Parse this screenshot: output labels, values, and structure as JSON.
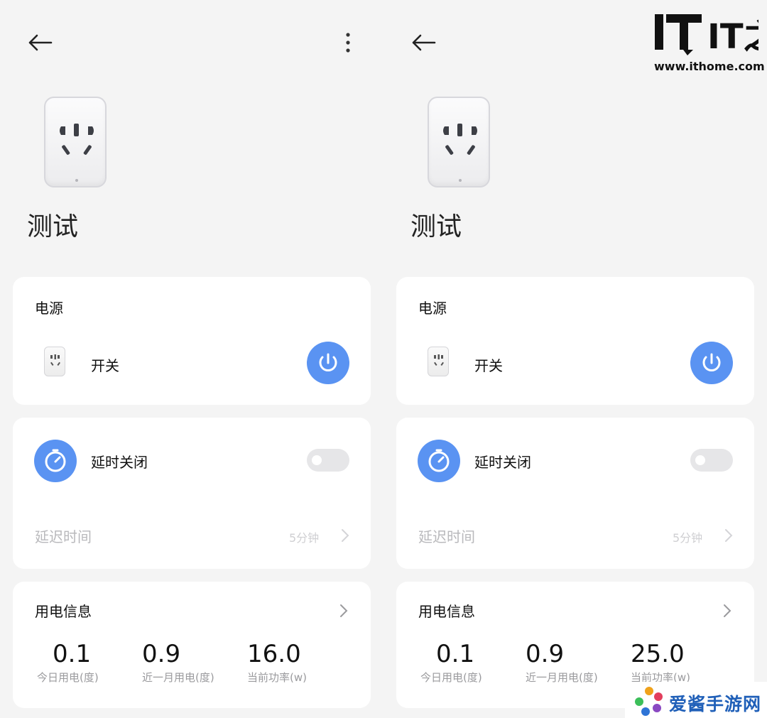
{
  "panels": [
    {
      "device_title": "测试",
      "power_card": {
        "section_title": "电源",
        "switch_label": "开关"
      },
      "timer_card": {
        "label": "延时关闭",
        "toggle_on": false,
        "delay_label": "延迟时间",
        "delay_value": "5分钟"
      },
      "usage_card": {
        "title": "用电信息",
        "stats": [
          {
            "value": "0.1",
            "label": "今日用电(度)"
          },
          {
            "value": "0.9",
            "label": "近一月用电(度)"
          },
          {
            "value": "16.0",
            "label": "当前功率(w)"
          }
        ]
      }
    },
    {
      "device_title": "测试",
      "power_card": {
        "section_title": "电源",
        "switch_label": "开关"
      },
      "timer_card": {
        "label": "延时关闭",
        "toggle_on": false,
        "delay_label": "延迟时间",
        "delay_value": "5分钟"
      },
      "usage_card": {
        "title": "用电信息",
        "stats": [
          {
            "value": "0.1",
            "label": "今日用电(度)"
          },
          {
            "value": "0.9",
            "label": "近一月用电(度)"
          },
          {
            "value": "25.0",
            "label": "当前功率(w)"
          }
        ]
      }
    }
  ],
  "branding": {
    "logo_text": "IT之家",
    "url": "www.ithome.com"
  },
  "watermark": {
    "text": "爱酱手游网"
  },
  "colors": {
    "accent": "#5a93f2",
    "background": "#f4f4f4",
    "card": "#ffffff"
  },
  "icons": [
    "back-arrow-icon",
    "more-vertical-icon",
    "power-icon",
    "timer-icon",
    "chevron-right-icon"
  ]
}
